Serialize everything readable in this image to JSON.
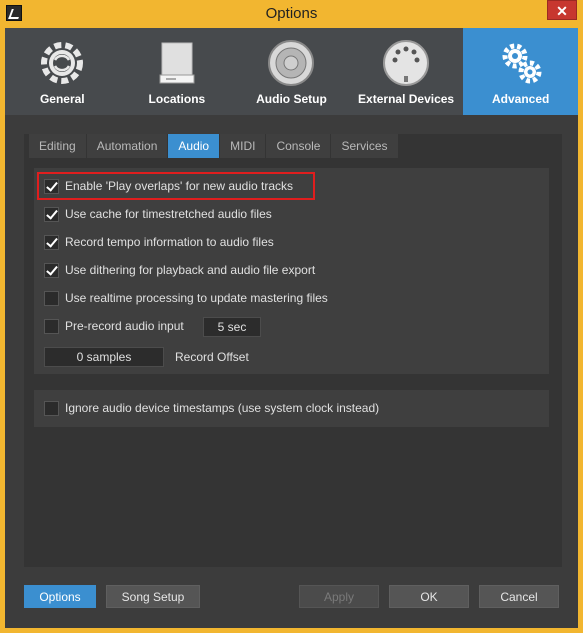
{
  "window": {
    "title": "Options",
    "close_label": "✕"
  },
  "topnav": {
    "items": [
      {
        "label": "General",
        "icon": "gear-refresh-icon"
      },
      {
        "label": "Locations",
        "icon": "drive-icon"
      },
      {
        "label": "Audio Setup",
        "icon": "speaker-icon"
      },
      {
        "label": "External Devices",
        "icon": "midi-port-icon"
      },
      {
        "label": "Advanced",
        "icon": "gears-icon",
        "active": true
      }
    ]
  },
  "tabs": [
    "Editing",
    "Automation",
    "Audio",
    "MIDI",
    "Console",
    "Services"
  ],
  "active_tab": "Audio",
  "options": [
    {
      "label": "Enable 'Play overlaps' for new audio tracks",
      "checked": true
    },
    {
      "label": "Use cache for timestretched audio files",
      "checked": true
    },
    {
      "label": "Record tempo information to audio files",
      "checked": true
    },
    {
      "label": "Use dithering for playback and audio file export",
      "checked": true
    },
    {
      "label": "Use realtime processing to update mastering files",
      "checked": false
    },
    {
      "label": "Pre-record audio input",
      "checked": false
    }
  ],
  "prerecord_value": "5 sec",
  "record_offset": {
    "value": "0 samples",
    "label": "Record Offset"
  },
  "ignore_timestamps": {
    "label": "Ignore audio device timestamps (use system clock instead)",
    "checked": false
  },
  "buttons": {
    "options": "Options",
    "song_setup": "Song Setup",
    "apply": "Apply",
    "ok": "OK",
    "cancel": "Cancel"
  },
  "colors": {
    "accent": "#3b8fd0",
    "titlebar": "#f2b630",
    "highlight": "#e01e1e"
  }
}
